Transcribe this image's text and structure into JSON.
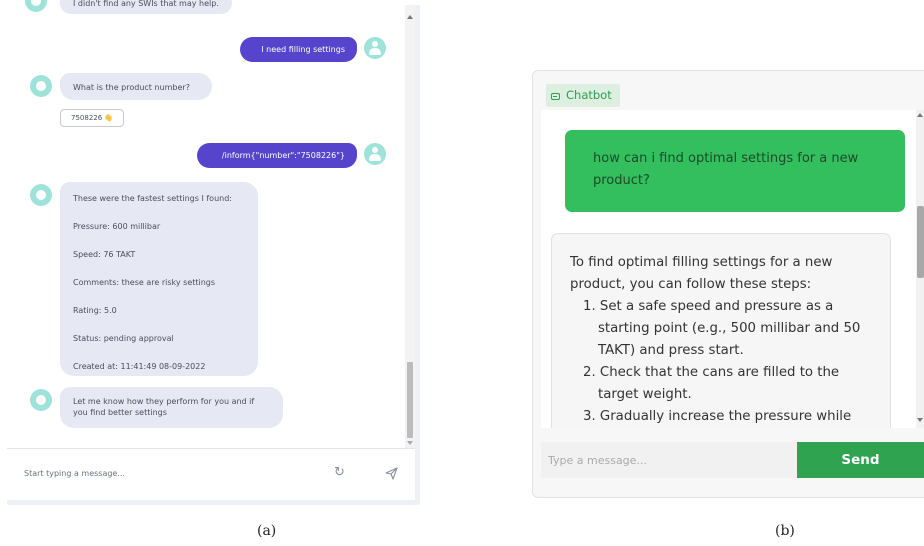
{
  "panel_a": {
    "top_partial": "I didn't find any SWIs that may help.",
    "messages": {
      "user_1": "I need filling settings",
      "bot_1": "What is the product number?",
      "quick_reply": "7508226 👋",
      "user_2": "/inform{\"number\":\"7508226\"}",
      "bot_2_lines": [
        "These were the fastest settings I found:",
        "Pressure: 600 millibar",
        "Speed: 76 TAKT",
        "Comments: these are risky settings",
        "Rating: 5.0",
        "Status: pending approval",
        "Created at: 11:41:49 08-09-2022"
      ],
      "bot_3_lines": [
        "Let me know how they perform for you and if",
        "you find better settings"
      ]
    },
    "input_placeholder": "Start typing a message...",
    "icons": [
      "refresh-icon",
      "send-icon"
    ]
  },
  "panel_b": {
    "tag": "Chatbot",
    "user_message_lines": [
      "how can i find optimal settings for a new",
      "product?"
    ],
    "bot_intro": [
      "To find optimal filling settings for a new",
      "product, you can follow these steps:"
    ],
    "steps": [
      {
        "first": "1. Set a safe speed and pressure as a",
        "cont": [
          "starting point (e.g., 500 millibar and 50",
          "TAKT) and press start."
        ]
      },
      {
        "first": "2. Check that the cans are filled to the",
        "cont": [
          "target weight."
        ]
      },
      {
        "first": "3. Gradually increase the pressure while",
        "cont": []
      }
    ],
    "input_placeholder": "Type a message...",
    "send_label": "Send",
    "colors": {
      "user_bubble": "#33bf5d",
      "send_button": "#2fa34f"
    }
  },
  "captions": {
    "a": "(a)",
    "b": "(b)"
  }
}
